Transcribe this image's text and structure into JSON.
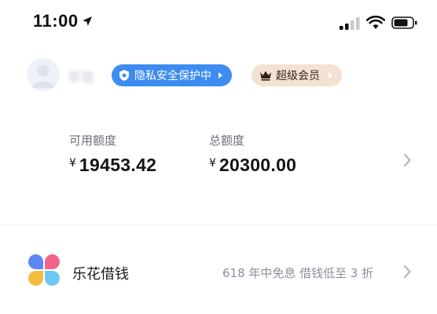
{
  "status_bar": {
    "time": "11:00"
  },
  "profile": {
    "username": "苹哥",
    "privacy_badge": {
      "label": "隐私安全保护中",
      "color": "#3d8cf0"
    },
    "vip_badge": {
      "label": "超级会员",
      "color": "#f3e2d1"
    }
  },
  "credit": {
    "available": {
      "label": "可用额度",
      "currency": "¥",
      "amount": "19453.42"
    },
    "total": {
      "label": "总额度",
      "currency": "¥",
      "amount": "20300.00"
    }
  },
  "loan": {
    "title": "乐花借钱",
    "promo": "618 年中免息 借钱低至 3 折",
    "logo_colors": [
      "#5d87f5",
      "#f0648b",
      "#f6bd3d",
      "#6cc7f2"
    ]
  },
  "icons": {
    "location": "location-arrow-icon",
    "signal": "signal-icon",
    "wifi": "wifi-icon",
    "battery": "battery-icon",
    "shield": "shield-icon",
    "crown": "crown-icon",
    "chevron": "chevron-right-icon"
  }
}
